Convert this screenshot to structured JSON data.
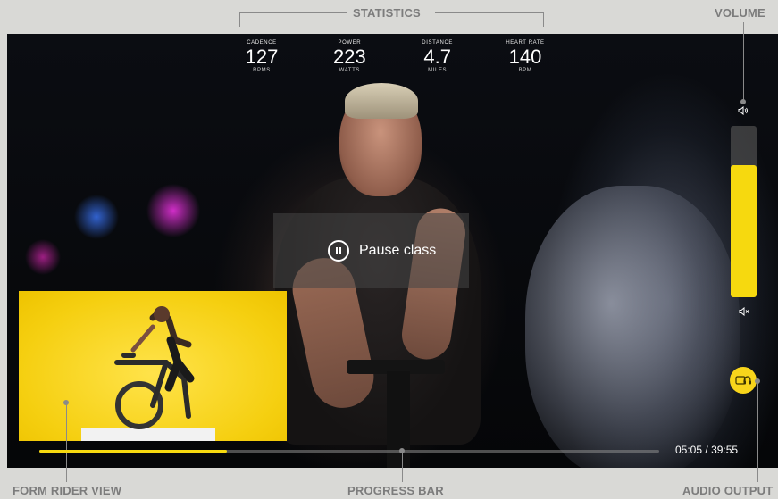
{
  "callouts": {
    "statistics": "STATISTICS",
    "volume": "VOLUME",
    "form_rider_view": "FORM RIDER VIEW",
    "progress_bar": "PROGRESS BAR",
    "audio_output": "AUDIO OUTPUT"
  },
  "stats": [
    {
      "label": "CADENCE",
      "value": "127",
      "unit": "RPMS"
    },
    {
      "label": "POWER",
      "value": "223",
      "unit": "WATTS"
    },
    {
      "label": "DISTANCE",
      "value": "4.7",
      "unit": "MILES"
    },
    {
      "label": "HEART RATE",
      "value": "140",
      "unit": "BPM"
    }
  ],
  "pause": {
    "label": "Pause class"
  },
  "volume": {
    "level": 0.77
  },
  "progress": {
    "fraction": 0.302,
    "time_elapsed": "05:05",
    "separator": "/",
    "time_total": "39:55"
  },
  "colors": {
    "accent": "#f6d90f",
    "callout_text": "#7c7c7c",
    "background": "#d9d9d6"
  },
  "icons": {
    "pause": "pause-icon",
    "volume_up": "speaker-icon",
    "mute": "speaker-mute-icon",
    "audio_output": "headphones-icon"
  }
}
